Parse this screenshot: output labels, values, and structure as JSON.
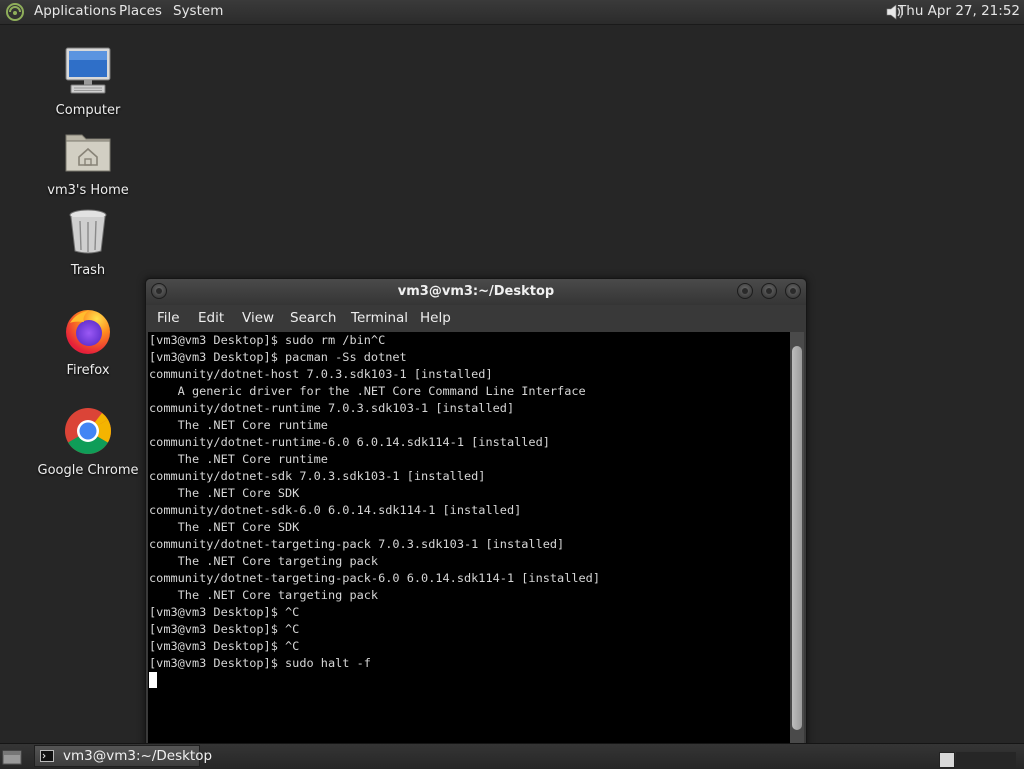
{
  "top_panel": {
    "menus": [
      "Applications",
      "Places",
      "System"
    ],
    "clock": "Thu Apr 27, 21:52"
  },
  "desktop_icons": [
    {
      "label": "Computer",
      "icon": "computer-icon"
    },
    {
      "label": "vm3's Home",
      "icon": "home-folder-icon"
    },
    {
      "label": "Trash",
      "icon": "trash-icon"
    },
    {
      "label": "Firefox",
      "icon": "firefox-icon"
    },
    {
      "label": "Google Chrome",
      "icon": "chrome-icon"
    }
  ],
  "window": {
    "title": "vm3@vm3:~/Desktop",
    "menu": [
      "File",
      "Edit",
      "View",
      "Search",
      "Terminal",
      "Help"
    ],
    "terminal_lines": [
      "[vm3@vm3 Desktop]$ sudo rm /bin^C",
      "[vm3@vm3 Desktop]$ pacman -Ss dotnet",
      "community/dotnet-host 7.0.3.sdk103-1 [installed]",
      "    A generic driver for the .NET Core Command Line Interface",
      "community/dotnet-runtime 7.0.3.sdk103-1 [installed]",
      "    The .NET Core runtime",
      "community/dotnet-runtime-6.0 6.0.14.sdk114-1 [installed]",
      "    The .NET Core runtime",
      "community/dotnet-sdk 7.0.3.sdk103-1 [installed]",
      "    The .NET Core SDK",
      "community/dotnet-sdk-6.0 6.0.14.sdk114-1 [installed]",
      "    The .NET Core SDK",
      "community/dotnet-targeting-pack 7.0.3.sdk103-1 [installed]",
      "    The .NET Core targeting pack",
      "community/dotnet-targeting-pack-6.0 6.0.14.sdk114-1 [installed]",
      "    The .NET Core targeting pack",
      "[vm3@vm3 Desktop]$ ^C",
      "[vm3@vm3 Desktop]$ ^C",
      "[vm3@vm3 Desktop]$ ^C",
      "[vm3@vm3 Desktop]$ sudo halt -f"
    ]
  },
  "taskbar": {
    "task_label": "vm3@vm3:~/Desktop"
  },
  "colors": {
    "desktop": "#262626",
    "terminal_bg": "#000000",
    "terminal_fg": "#d6d6d6"
  }
}
